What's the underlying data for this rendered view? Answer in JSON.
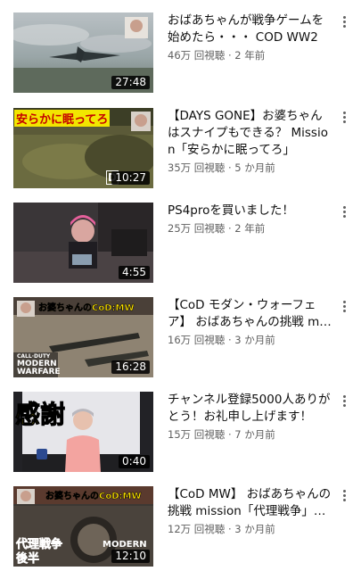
{
  "videos": [
    {
      "title": "おばあちゃんが戦争ゲームを始めたら・・・ COD WW2",
      "views": "46万 回視聴",
      "age": "2 年前",
      "duration": "27:48",
      "overlay": ""
    },
    {
      "title": "【DAYS GONE】お婆ちゃんはスナイプもできる？ Mission「安らかに眠ってろ」",
      "views": "35万 回視聴",
      "age": "5 か月前",
      "duration": "10:27",
      "overlay": "安らかに眠ってろ",
      "overlay2": "D"
    },
    {
      "title": "PS4proを買いました！",
      "views": "25万 回視聴",
      "age": "2 年前",
      "duration": "4:55",
      "overlay": ""
    },
    {
      "title": "【CoD モダン・ウォーフェア】 おばあちゃんの挑戦 mission「武器工場」",
      "views": "16万 回視聴",
      "age": "3 か月前",
      "duration": "16:28",
      "overlay": "お婆ちゃんのCoD:MW",
      "overlay2": "CALL·DUTY",
      "overlay3": "MODERN",
      "overlay4": "WARFARE"
    },
    {
      "title": "チャンネル登録5000人ありがとう！お礼申し上げます！",
      "views": "15万 回視聴",
      "age": "7 か月前",
      "duration": "0:40",
      "overlay": "感謝"
    },
    {
      "title": "【CoD MW】 おばあちゃんの挑戦 mission「代理戦争」後半",
      "views": "12万 回視聴",
      "age": "3 か月前",
      "duration": "12:10",
      "overlay": "お婆ちゃんのCoD:MW",
      "overlay2": "代理戦争",
      "overlay3": "後半",
      "overlay4": "MODERN"
    }
  ],
  "sep": "·",
  "icons": {
    "more": "more-vert-icon"
  }
}
